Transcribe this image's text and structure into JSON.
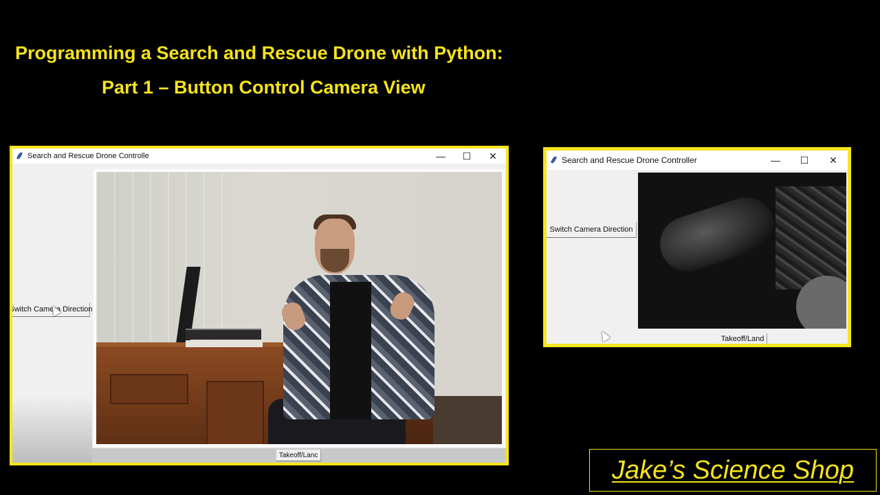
{
  "heading": {
    "line1": "Programming a Search and Rescue Drone with Python:",
    "line2": "Part 1 – Button Control Camera View"
  },
  "window_big": {
    "title": "Search and Rescue Drone Controlle",
    "switch_button": "Switch Camera Direction",
    "takeoff_button": "Takeoff/Lanc",
    "controls": {
      "minimize": "—",
      "maximize": "☐",
      "close": "✕"
    }
  },
  "window_small": {
    "title": "Search and Rescue Drone Controller",
    "switch_button": "Switch Camera Direction",
    "takeoff_button": "Takeoff/Land",
    "controls": {
      "minimize": "—",
      "maximize": "☐",
      "close": "✕"
    }
  },
  "brand": {
    "text": "Jake’s Science Shop"
  },
  "colors": {
    "accent": "#f5e31e",
    "background": "#000000"
  },
  "icons": {
    "app": "feather-icon",
    "cursor": "mouse-pointer-icon"
  }
}
